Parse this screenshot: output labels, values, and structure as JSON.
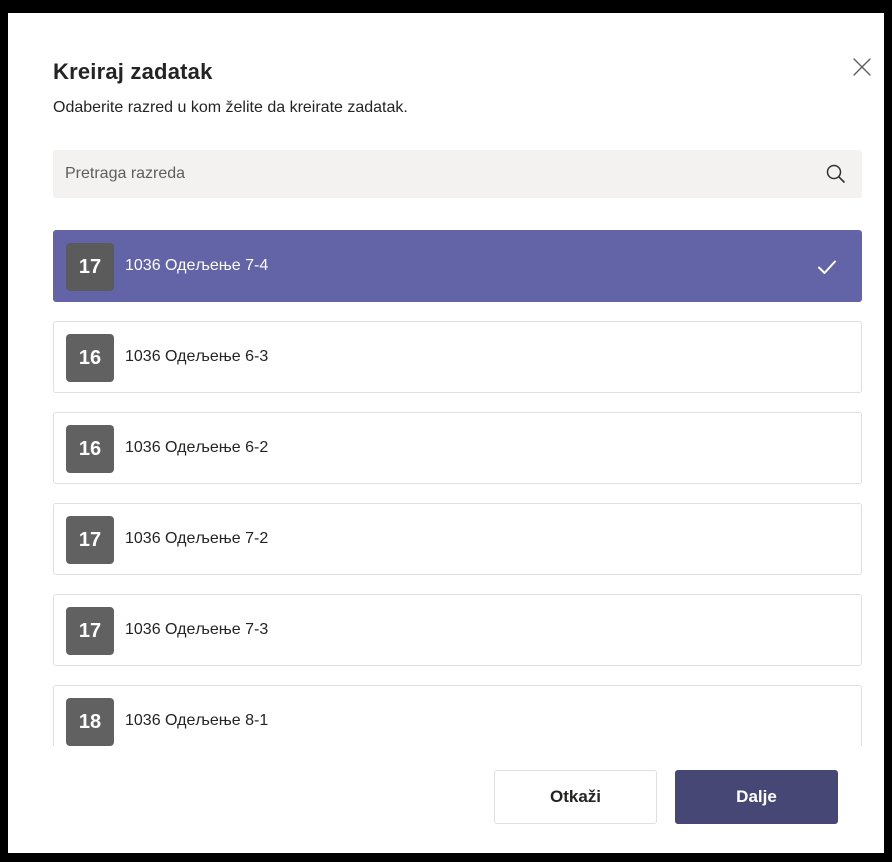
{
  "dialog": {
    "title": "Kreiraj zadatak",
    "subtitle": "Odaberite razred u kom želite da kreirate zadatak.",
    "close_icon": "close-icon"
  },
  "search": {
    "placeholder": "Pretraga razreda",
    "value": "",
    "icon": "search-icon"
  },
  "classes": [
    {
      "badge": "17",
      "label": "1036 Одељење 7-4",
      "selected": true
    },
    {
      "badge": "16",
      "label": "1036 Одељење 6-3",
      "selected": false
    },
    {
      "badge": "16",
      "label": "1036 Одељење 6-2",
      "selected": false
    },
    {
      "badge": "17",
      "label": "1036 Одељење 7-2",
      "selected": false
    },
    {
      "badge": "17",
      "label": "1036 Одељење 7-3",
      "selected": false
    },
    {
      "badge": "18",
      "label": "1036 Одељење 8-1",
      "selected": false
    }
  ],
  "footer": {
    "cancel_label": "Otkaži",
    "next_label": "Dalje"
  },
  "colors": {
    "selected_bg": "#6264a7",
    "primary_button": "#464775",
    "badge_bg": "#616161"
  }
}
